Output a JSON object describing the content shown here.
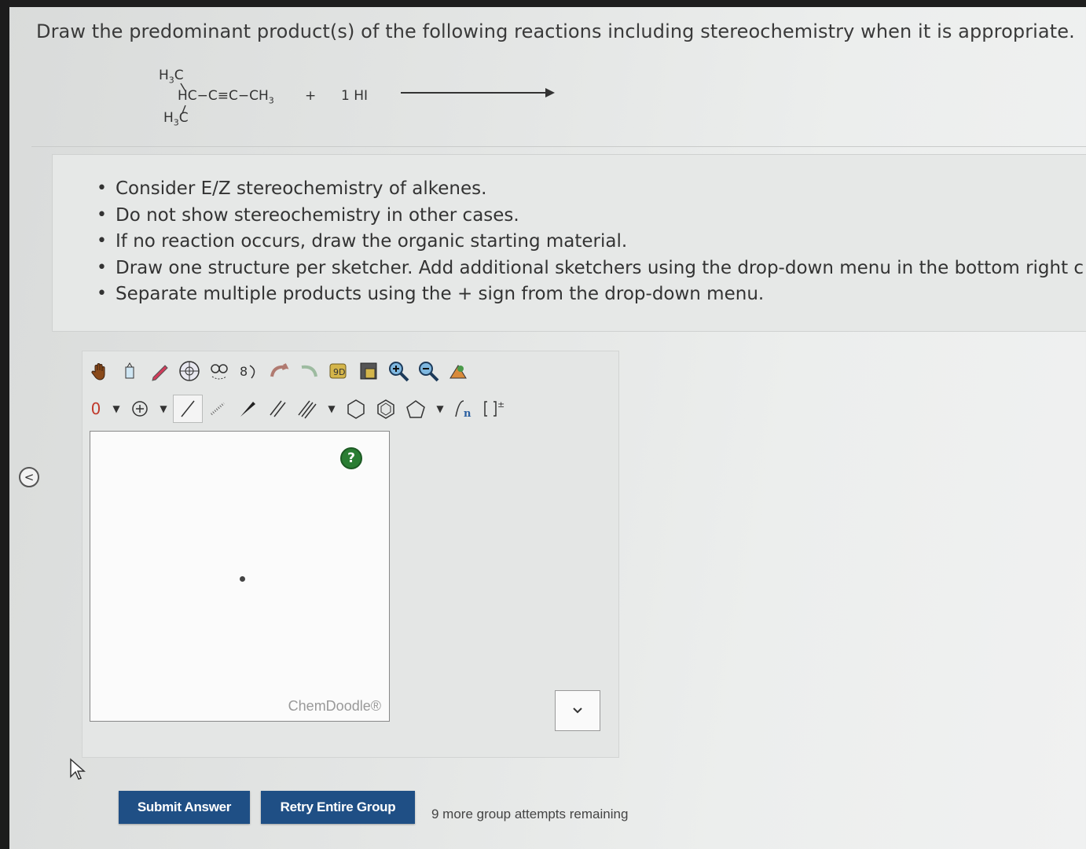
{
  "question": "Draw the predominant product(s) of the following reactions including stereochemistry when it is appropriate.",
  "reaction": {
    "h3c_top": "H",
    "h3c_top_sub": "3",
    "h3c_top_c": "C",
    "main_chain": "HC−C≡C−CH",
    "main_chain_sub": "3",
    "h3c_bottom": "H",
    "h3c_bottom_sub": "3",
    "h3c_bottom_c": "C",
    "plus": "+",
    "reagent": "1 HI"
  },
  "instructions": [
    "Consider E/Z stereochemistry of alkenes.",
    "Do not show stereochemistry in other cases.",
    "If no reaction occurs, draw the organic starting material.",
    "Draw one structure per sketcher. Add additional sketchers using the drop-down menu in the bottom right c",
    "Separate multiple products using the + sign from the drop-down menu."
  ],
  "toolbar": {
    "charge_label": "0",
    "help_label": "?",
    "watermark": "ChemDoodle®"
  },
  "buttons": {
    "submit": "Submit Answer",
    "retry": "Retry Entire Group"
  },
  "attempts_text": "9 more group attempts remaining",
  "icons": [
    "hand-icon",
    "eraser-icon",
    "pencil-icon",
    "ring-template-icon",
    "lasso-icon",
    "rotate-icon",
    "undo-icon",
    "redo-icon",
    "copy-icon",
    "paste-icon",
    "zoom-in-icon",
    "zoom-out-icon",
    "clean-icon",
    "plus-charge-icon",
    "single-bond-icon",
    "wedge-bond-icon",
    "double-bond-icon",
    "triple-bond-icon",
    "hexagon-icon",
    "benzene-icon",
    "pentagon-icon",
    "repeat-unit-icon",
    "bracket-icon",
    "chevron-down-icon",
    "collapse-left-icon"
  ]
}
